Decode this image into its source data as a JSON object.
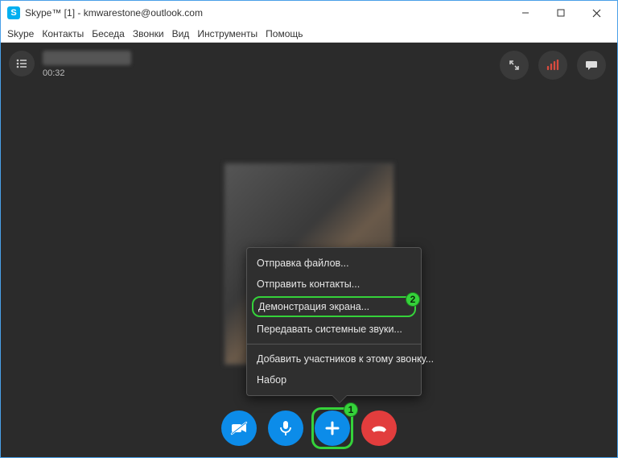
{
  "window": {
    "title": "Skype™ [1] - kmwarestone@outlook.com"
  },
  "menu": {
    "items": [
      "Skype",
      "Контакты",
      "Беседа",
      "Звонки",
      "Вид",
      "Инструменты",
      "Помощь"
    ]
  },
  "call": {
    "duration": "00:32"
  },
  "popup": {
    "send_files": "Отправка файлов...",
    "send_contacts": "Отправить контакты...",
    "share_screen": "Демонстрация экрана...",
    "share_audio": "Передавать системные звуки...",
    "add_participants": "Добавить участников к этому звонку...",
    "dial": "Набор"
  },
  "callouts": {
    "one": "1",
    "two": "2"
  },
  "icons": {
    "fullscreen": "fullscreen-icon",
    "signal": "signal-icon",
    "chat": "chat-icon",
    "list": "list-icon",
    "camera": "camera-off-icon",
    "mic": "mic-icon",
    "plus": "plus-icon",
    "hangup": "hangup-icon"
  }
}
